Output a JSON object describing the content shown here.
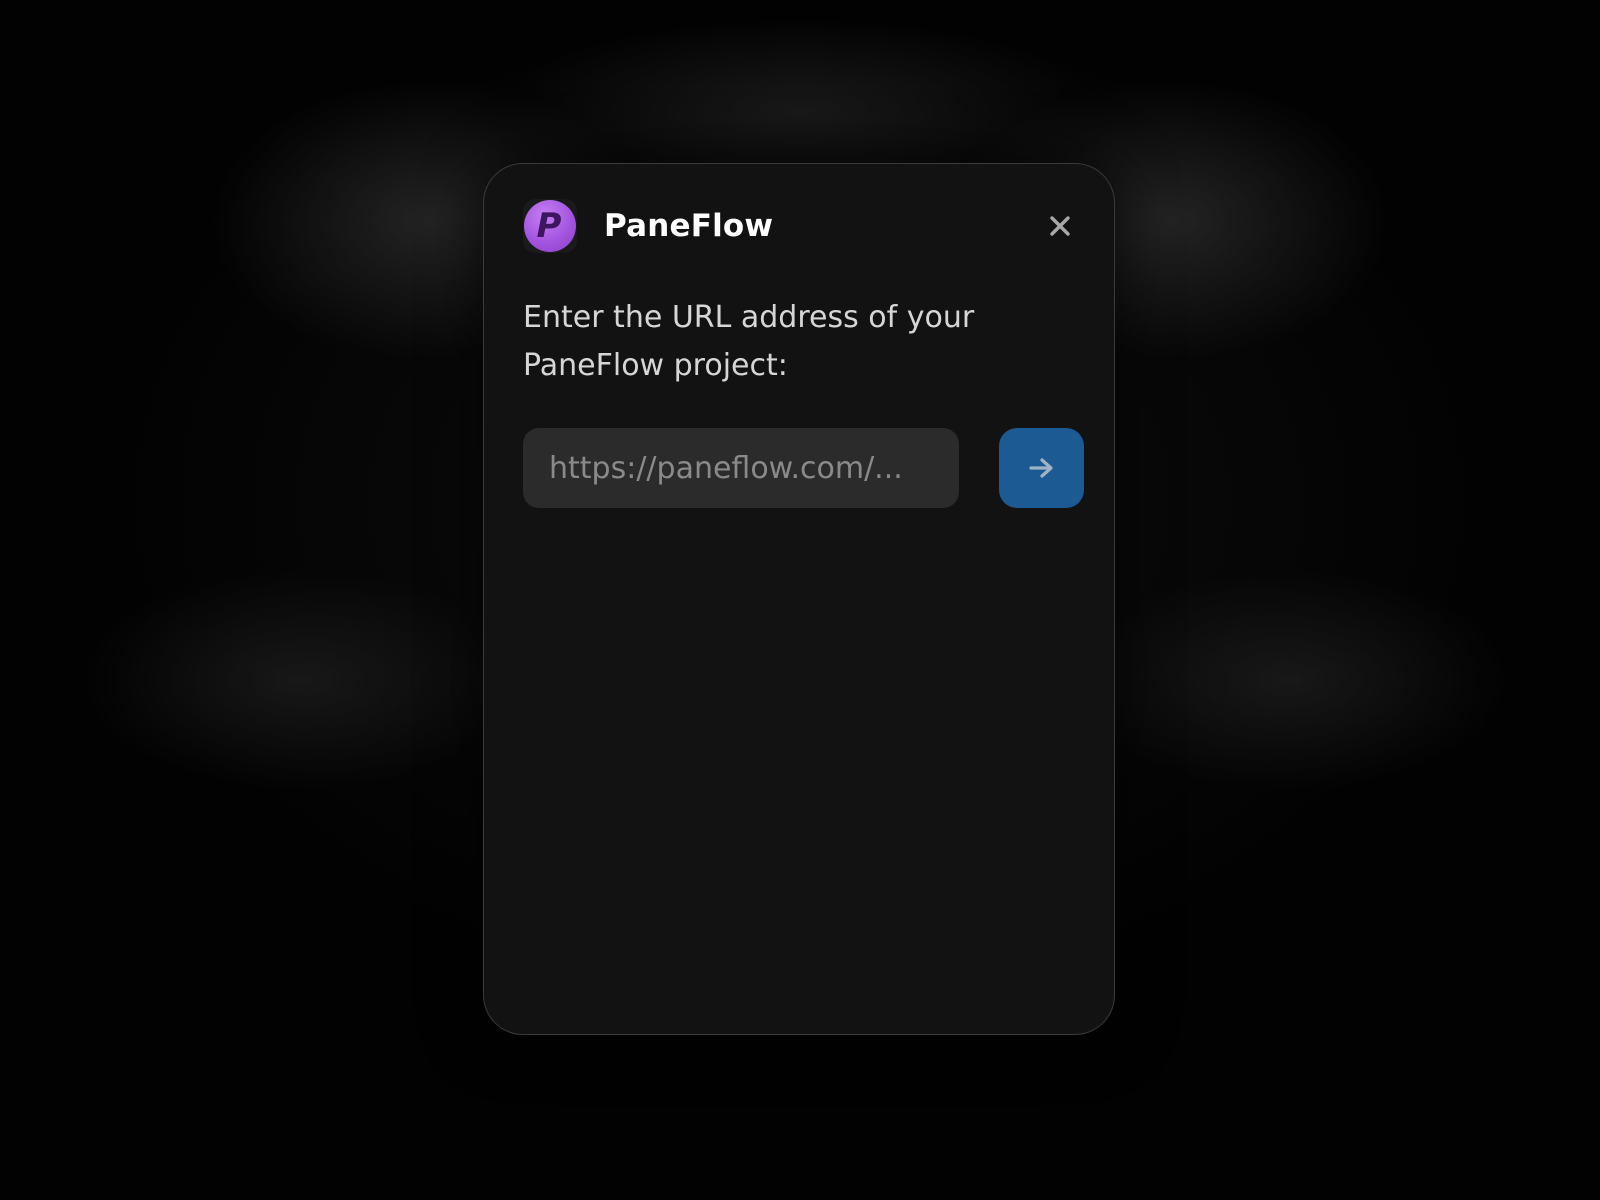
{
  "dialog": {
    "app_name": "PaneFlow",
    "logo_letter": "P",
    "prompt": "Enter the URL address of your PaneFlow project:",
    "url_input": {
      "value": "",
      "placeholder": "https://paneflow.com/..."
    },
    "close_icon": "close-icon",
    "submit_icon": "arrow-right-icon"
  },
  "colors": {
    "background": "#020202",
    "dialog_background": "#121212",
    "input_background": "#2b2b2b",
    "submit_button": "#1b5a92",
    "logo_purple": "#a455e0"
  }
}
